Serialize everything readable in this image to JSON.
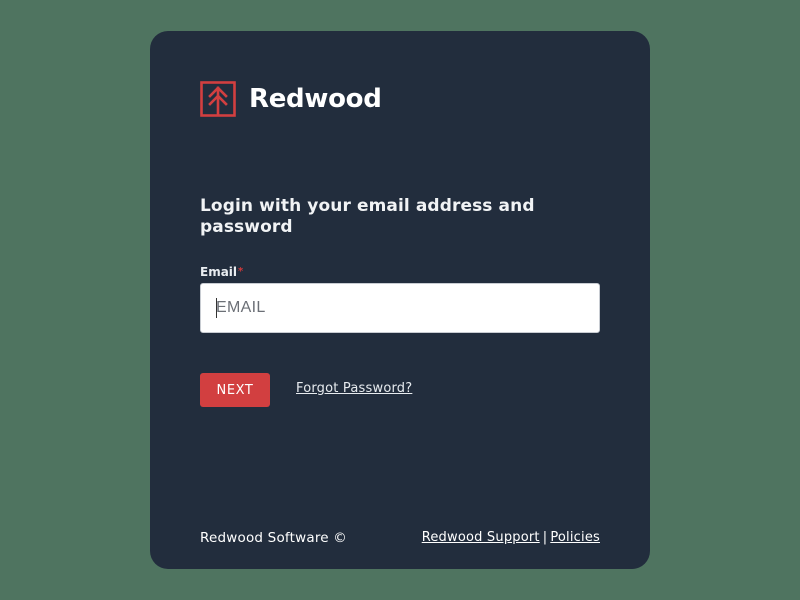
{
  "brand": {
    "name": "Redwood",
    "logo_icon": "redwood-tree-logo",
    "accent_color": "#d23f40"
  },
  "login": {
    "heading": "Login with your email address and password",
    "email_label": "Email",
    "required_marker": "*",
    "email_placeholder": "EMAIL",
    "email_value": "",
    "next_label": "NEXT",
    "forgot_label": "Forgot Password?"
  },
  "footer": {
    "copyright": "Redwood Software ©",
    "support_label": "Redwood Support",
    "separator": "|",
    "policies_label": "Policies"
  },
  "colors": {
    "page_background": "#4f7460",
    "card_background": "#222d3d",
    "button_background": "#d23f40",
    "text": "#ffffff"
  }
}
